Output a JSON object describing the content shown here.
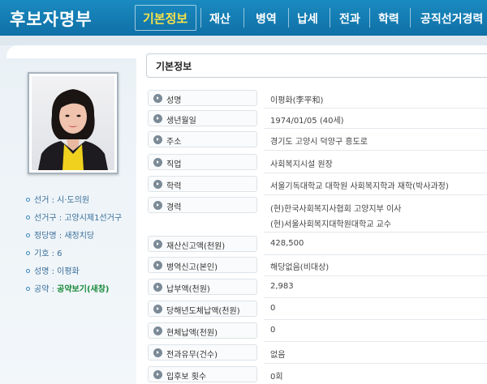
{
  "header": {
    "title": "후보자명부",
    "tabs": [
      {
        "label": "기본정보",
        "active": true
      },
      {
        "label": "재산"
      },
      {
        "label": "병역"
      },
      {
        "label": "납세"
      },
      {
        "label": "전과"
      },
      {
        "label": "학력"
      },
      {
        "label": "공직선거경력"
      }
    ]
  },
  "sidebar": {
    "items": [
      {
        "label": "선거 : ",
        "value": "시·도의원"
      },
      {
        "label": "선거구 : ",
        "value": "고양시제1선거구"
      },
      {
        "label": "정당명 : ",
        "value": "새정치당"
      },
      {
        "label": "기호 : ",
        "value": "6"
      },
      {
        "label": "성명 : ",
        "value": "이평화"
      },
      {
        "label": "공약 : ",
        "value": "공약보기(새창)"
      }
    ]
  },
  "main": {
    "section_title": "기본정보",
    "rows": [
      {
        "label": "성명",
        "value": "이평화(李平和)"
      },
      {
        "label": "생년월일",
        "value": "1974/01/05 (40세)"
      },
      {
        "label": "주소",
        "value": "경기도 고양시 덕양구 흥도로"
      },
      {
        "label": "직업",
        "value": "사회복지시설 원장"
      },
      {
        "label": "학력",
        "value": "서울기독대학교 대학원 사회복지학과 재학(박사과정)"
      },
      {
        "label": "경력",
        "value": "(현)한국사회복지사협회 고양지부 이사",
        "value2": "(현)서울사회복지대학원대학교 교수"
      },
      {
        "label": "재산신고액(천원)",
        "value": "428,500"
      },
      {
        "label": "병역신고(본인)",
        "value": "해당없음(비대상)"
      },
      {
        "label": "납부액(천원)",
        "value": "2,983"
      },
      {
        "label": "당해년도체납액(천원)",
        "value": "0"
      },
      {
        "label": "현체납액(천원)",
        "value": "0"
      },
      {
        "label": "전과유무(건수)",
        "value": "없음"
      },
      {
        "label": "입후보 횟수",
        "value": "0회"
      }
    ]
  },
  "colors": {
    "header": "#1179b2",
    "active_tab": "#f6e24a",
    "pledge": "#1b8a3c",
    "sidebar_text": "#3a6f9a"
  }
}
